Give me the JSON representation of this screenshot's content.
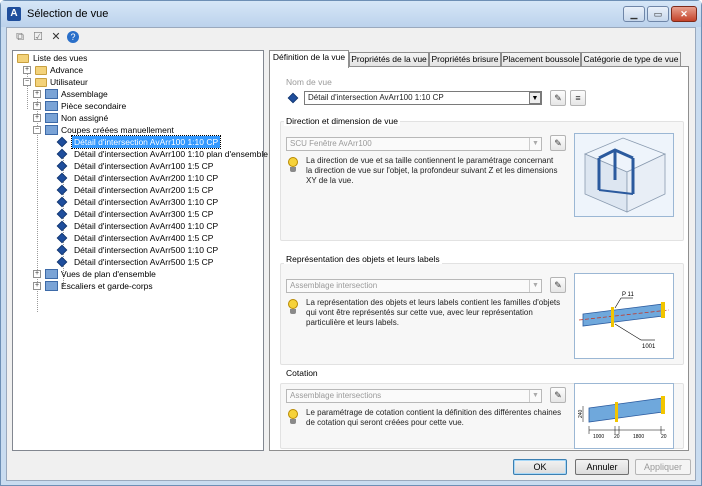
{
  "window": {
    "title": "Sélection de vue"
  },
  "tree": {
    "root": "Liste des vues",
    "advance": "Advance",
    "utilisateur": "Utilisateur",
    "groups": [
      "Assemblage",
      "Pièce secondaire",
      "Non assigné",
      "Coupes créées manuellement"
    ],
    "views": [
      "Détail d'intersection AvArr100 1:10 CP",
      "Détail d'intersection AvArr100 1:10 plan d'ensemble",
      "Détail d'intersection AvArr100 1:5 CP",
      "Détail d'intersection AvArr200 1:10 CP",
      "Détail d'intersection AvArr200 1:5 CP",
      "Détail d'intersection AvArr300 1:10 CP",
      "Détail d'intersection AvArr300 1:5 CP",
      "Détail d'intersection AvArr400 1:10 CP",
      "Détail d'intersection AvArr400 1:5 CP",
      "Détail d'intersection AvArr500 1:10 CP",
      "Détail d'intersection AvArr500 1:5 CP"
    ],
    "bottom": [
      "Vues de plan d'ensemble",
      "Escaliers et garde-corps"
    ]
  },
  "tabs": [
    "Définition de la vue",
    "Propriétés de la vue",
    "Propriétés brisure",
    "Placement boussole",
    "Catégorie de type de vue"
  ],
  "nom_de_vue": {
    "label": "Nom de vue",
    "value": "Détail d'intersection AvArr100 1:10 CP"
  },
  "direction": {
    "title": "Direction et dimension de vue",
    "value": "SCU Fenêtre AvArr100",
    "desc": [
      "La direction de vue et sa taille contiennent le paramétrage concernant",
      "la direction de vue sur l'objet, la profondeur suivant Z et les dimensions",
      "XY de la vue."
    ]
  },
  "representation": {
    "title": "Représentation des objets et leurs labels",
    "value": "Assemblage intersection",
    "desc": [
      "La représentation des objets et leurs labels contient les familles d'objets",
      "qui vont être représentés sur cette vue, avec leur représentation",
      "particulière et leurs labels."
    ],
    "labels": {
      "top": "P 11",
      "bottom": "1001"
    }
  },
  "cotation": {
    "title": "Cotation",
    "value": "Assemblage intersections",
    "desc": [
      "Le paramétrage de cotation contient la définition des différentes chaines",
      "de cotation qui seront créées pour cette vue."
    ],
    "labels": {
      "h": "240",
      "a": "1000",
      "b": "20",
      "c": "1800",
      "d": "20"
    }
  },
  "buttons": {
    "ok": "OK",
    "cancel": "Annuler",
    "apply": "Appliquer"
  }
}
